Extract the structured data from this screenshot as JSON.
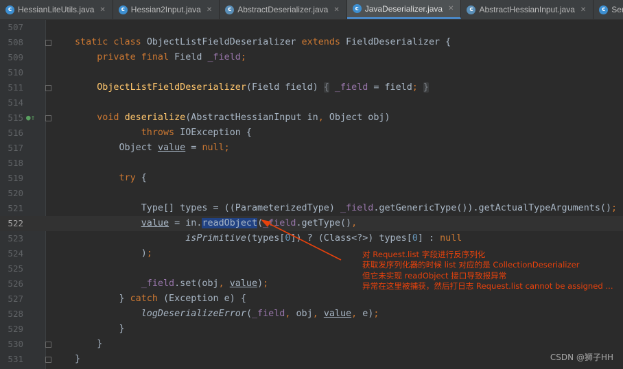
{
  "tabs": [
    {
      "label": "HessianLiteUtils.java",
      "icon": "java-class-icon",
      "active": false
    },
    {
      "label": "Hessian2Input.java",
      "icon": "java-class-icon",
      "active": false
    },
    {
      "label": "AbstractDeserializer.java",
      "icon": "java-abstract-class-icon",
      "active": false
    },
    {
      "label": "JavaDeserializer.java",
      "icon": "java-class-icon",
      "active": true
    },
    {
      "label": "AbstractHessianInput.java",
      "icon": "java-abstract-class-icon",
      "active": false
    },
    {
      "label": "SerializerFactor",
      "icon": "java-class-icon",
      "active": false
    }
  ],
  "editor": {
    "current_line": 522,
    "lines": [
      {
        "num": "507",
        "tokens": []
      },
      {
        "num": "508",
        "tokens": [
          [
            "kw",
            "static class "
          ],
          [
            "t",
            "ObjectListFieldDeserializer "
          ],
          [
            "kw",
            "extends "
          ],
          [
            "t",
            "FieldDeserializer {"
          ]
        ]
      },
      {
        "num": "509",
        "tokens": [
          [
            "t",
            "    "
          ],
          [
            "kw",
            "private final "
          ],
          [
            "t",
            "Field "
          ],
          [
            "field",
            "_field"
          ],
          [
            "kw",
            ";"
          ]
        ]
      },
      {
        "num": "510",
        "tokens": []
      },
      {
        "num": "511",
        "tokens": [
          [
            "t",
            "    "
          ],
          [
            "fn",
            "ObjectListFieldDeserializer"
          ],
          [
            "t",
            "(Field field) "
          ],
          [
            "fold",
            "{"
          ],
          [
            "t",
            " "
          ],
          [
            "field",
            "_field"
          ],
          [
            "t",
            " = field"
          ],
          [
            "kw",
            ";"
          ],
          [
            "t",
            " "
          ],
          [
            "fold",
            "}"
          ]
        ]
      },
      {
        "num": "514",
        "tokens": []
      },
      {
        "num": "515",
        "tokens": [
          [
            "t",
            "    "
          ],
          [
            "kw",
            "void "
          ],
          [
            "fn",
            "deserialize"
          ],
          [
            "t",
            "(AbstractHessianInput in"
          ],
          [
            "kw",
            ", "
          ],
          [
            "t",
            "Object obj)"
          ]
        ]
      },
      {
        "num": "516",
        "tokens": [
          [
            "t",
            "            "
          ],
          [
            "kw",
            "throws "
          ],
          [
            "t",
            "IOException {"
          ]
        ]
      },
      {
        "num": "517",
        "tokens": [
          [
            "t",
            "        Object "
          ],
          [
            "u",
            "value"
          ],
          [
            "t",
            " = "
          ],
          [
            "kw",
            "null;"
          ]
        ]
      },
      {
        "num": "518",
        "tokens": []
      },
      {
        "num": "519",
        "tokens": [
          [
            "t",
            "        "
          ],
          [
            "kw",
            "try "
          ],
          [
            "t",
            "{"
          ]
        ]
      },
      {
        "num": "520",
        "tokens": []
      },
      {
        "num": "521",
        "tokens": [
          [
            "t",
            "            Type[] types = ((ParameterizedType) "
          ],
          [
            "field",
            "_field"
          ],
          [
            "t",
            ".getGenericType()).getActualTypeArguments()"
          ],
          [
            "kw",
            ";"
          ]
        ]
      },
      {
        "num": "522",
        "tokens": [
          [
            "t",
            "            "
          ],
          [
            "u",
            "value"
          ],
          [
            "t",
            " = in."
          ],
          [
            "sel",
            "readObject"
          ],
          [
            "t",
            "("
          ],
          [
            "field",
            "_field"
          ],
          [
            "t",
            ".getType()"
          ],
          [
            "kw",
            ","
          ]
        ]
      },
      {
        "num": "523",
        "tokens": [
          [
            "t",
            "                    "
          ],
          [
            "it",
            "isPrimitive"
          ],
          [
            "t",
            "(types["
          ],
          [
            "num",
            "0"
          ],
          [
            "t",
            "]) ? (Class<?>) types["
          ],
          [
            "num",
            "0"
          ],
          [
            "t",
            "] : "
          ],
          [
            "kw",
            "null"
          ]
        ]
      },
      {
        "num": "524",
        "tokens": [
          [
            "t",
            "            )"
          ],
          [
            "kw",
            ";"
          ]
        ]
      },
      {
        "num": "525",
        "tokens": []
      },
      {
        "num": "526",
        "tokens": [
          [
            "t",
            "            "
          ],
          [
            "field",
            "_field"
          ],
          [
            "t",
            ".set(obj"
          ],
          [
            "kw",
            ", "
          ],
          [
            "u",
            "value"
          ],
          [
            "t",
            ")"
          ],
          [
            "kw",
            ";"
          ]
        ]
      },
      {
        "num": "527",
        "tokens": [
          [
            "t",
            "        } "
          ],
          [
            "kw",
            "catch "
          ],
          [
            "t",
            "(Exception e) {"
          ]
        ]
      },
      {
        "num": "528",
        "tokens": [
          [
            "t",
            "            "
          ],
          [
            "it",
            "logDeserializeError"
          ],
          [
            "t",
            "("
          ],
          [
            "field",
            "_field"
          ],
          [
            "kw",
            ", "
          ],
          [
            "t",
            "obj"
          ],
          [
            "kw",
            ", "
          ],
          [
            "u",
            "value"
          ],
          [
            "kw",
            ", "
          ],
          [
            "t",
            "e)"
          ],
          [
            "kw",
            ";"
          ]
        ]
      },
      {
        "num": "529",
        "tokens": [
          [
            "t",
            "        }"
          ]
        ]
      },
      {
        "num": "530",
        "tokens": [
          [
            "t",
            "    }"
          ]
        ]
      },
      {
        "num": "531",
        "tokens": [
          [
            "t",
            "}"
          ]
        ]
      }
    ]
  },
  "annotation": {
    "lines": [
      "对 Request.list 字段进行反序列化",
      "获取发序列化器的时候 list 对应的是 CollectionDeserializer",
      "但它未实现 readObject 接口导致报异常",
      "异常在这里被捕获，然后打日志 Request.list cannot be assigned ..."
    ],
    "color": "#e8420c"
  },
  "watermark": "CSDN @狮子HH",
  "colors": {
    "keyword": "#cc7832",
    "field": "#9876aa",
    "method": "#ffc66d",
    "number": "#6897bb",
    "text": "#a9b7c6",
    "background": "#2b2b2b"
  }
}
